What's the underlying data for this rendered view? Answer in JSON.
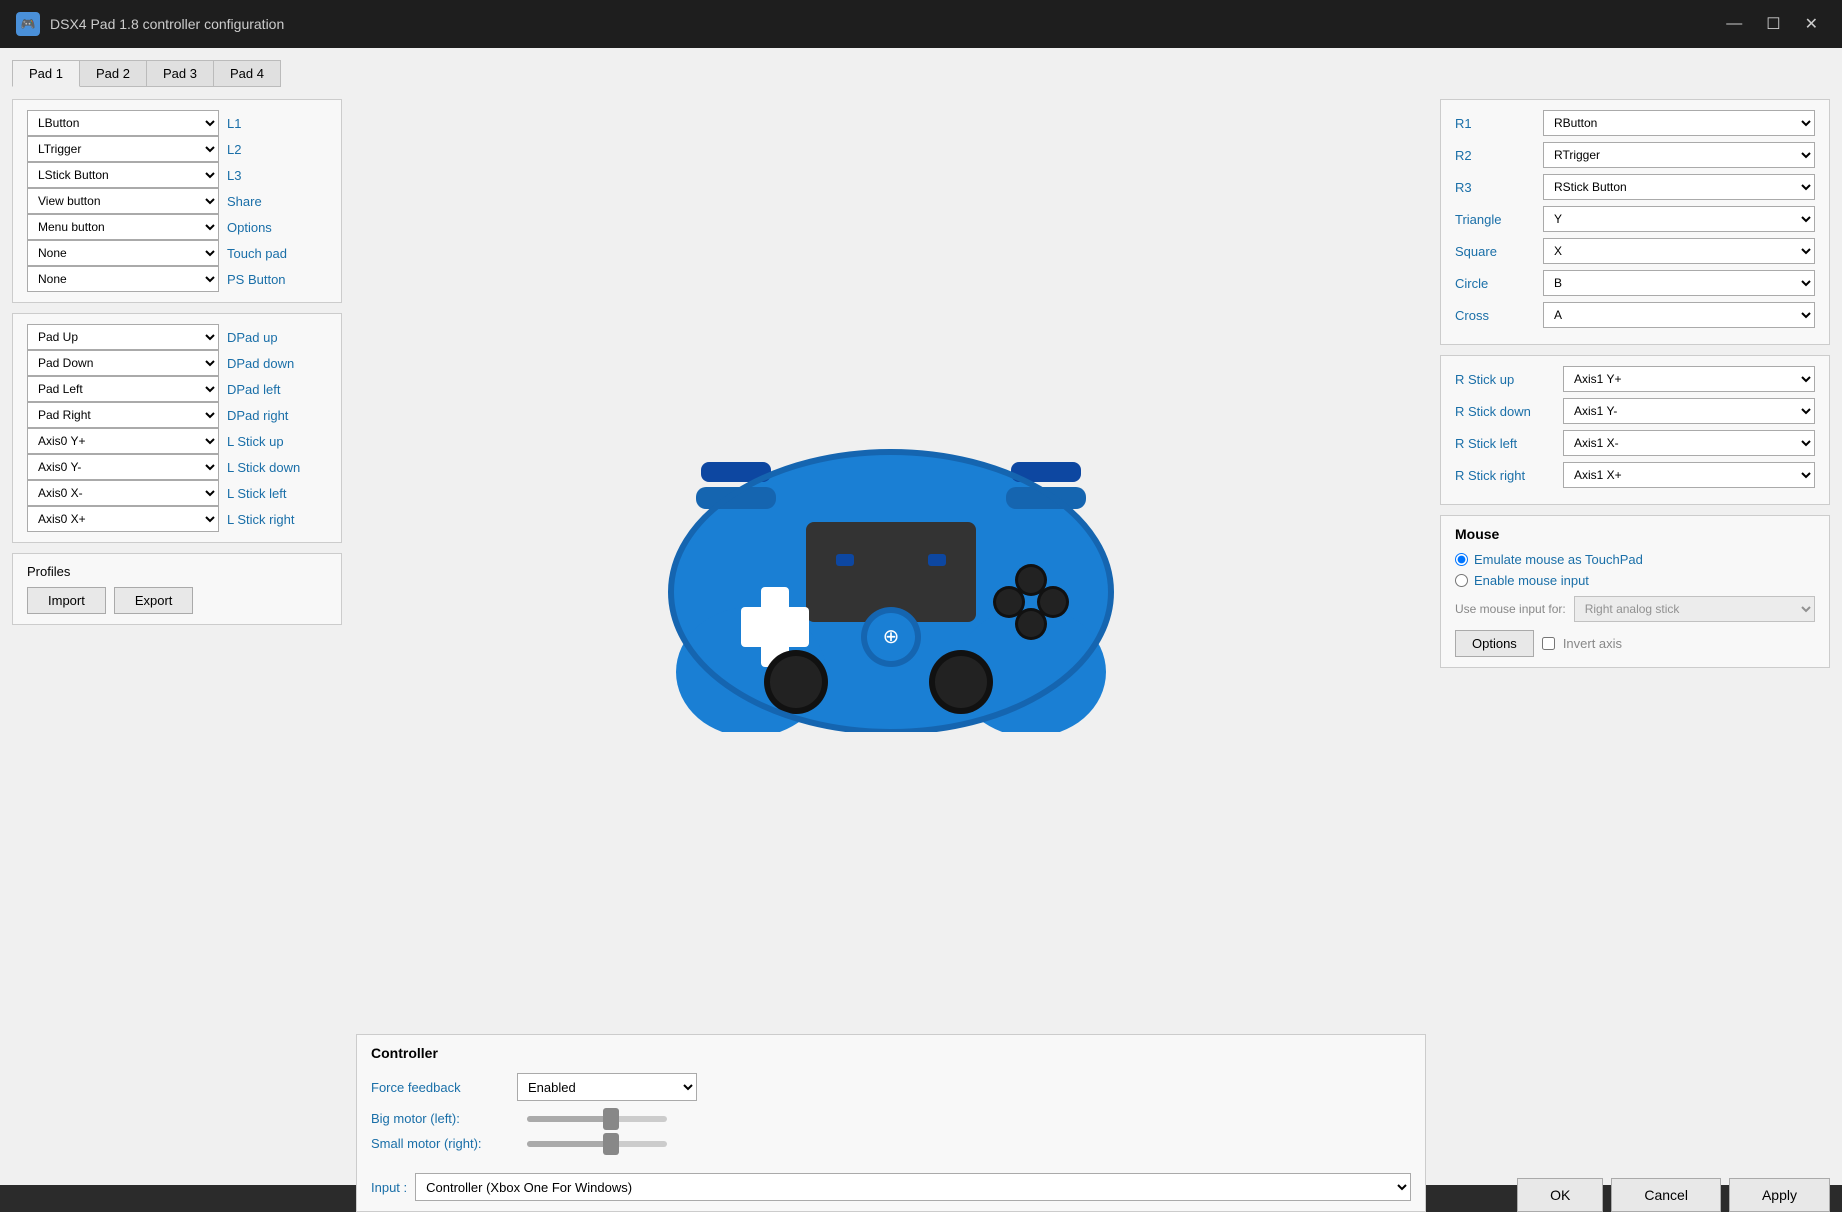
{
  "window": {
    "title": "DSX4 Pad 1.8 controller configuration",
    "icon": "🎮"
  },
  "titlebar": {
    "minimize": "—",
    "maximize": "☐",
    "close": "✕"
  },
  "tabs": [
    {
      "label": "Pad 1",
      "active": true
    },
    {
      "label": "Pad 2",
      "active": false
    },
    {
      "label": "Pad 3",
      "active": false
    },
    {
      "label": "Pad 4",
      "active": false
    }
  ],
  "left_mappings": [
    {
      "key": "L1",
      "value": "LButton"
    },
    {
      "key": "L2",
      "value": "LTrigger"
    },
    {
      "key": "L3",
      "value": "LStick Button"
    },
    {
      "key": "Share",
      "value": "View button"
    },
    {
      "key": "Options",
      "value": "Menu button"
    },
    {
      "key": "Touch pad",
      "value": "None"
    },
    {
      "key": "PS Button",
      "value": "None"
    }
  ],
  "dpad_mappings": [
    {
      "key": "DPad up",
      "value": "Pad Up"
    },
    {
      "key": "DPad down",
      "value": "Pad Down"
    },
    {
      "key": "DPad left",
      "value": "Pad Left"
    },
    {
      "key": "DPad right",
      "value": "Pad Right"
    }
  ],
  "lstick_mappings": [
    {
      "key": "L Stick up",
      "value": "Axis0 Y+"
    },
    {
      "key": "L Stick down",
      "value": "Axis0 Y-"
    },
    {
      "key": "L Stick left",
      "value": "Axis0 X-"
    },
    {
      "key": "L Stick right",
      "value": "Axis0 X+"
    }
  ],
  "profiles": {
    "title": "Profiles",
    "import": "Import",
    "export": "Export"
  },
  "right_button_mappings": [
    {
      "key": "R1",
      "value": "RButton"
    },
    {
      "key": "R2",
      "value": "RTrigger"
    },
    {
      "key": "R3",
      "value": "RStick Button"
    },
    {
      "key": "Triangle",
      "value": "Y"
    },
    {
      "key": "Square",
      "value": "X"
    },
    {
      "key": "Circle",
      "value": "B"
    },
    {
      "key": "Cross",
      "value": "A"
    }
  ],
  "rstick_mappings": [
    {
      "key": "R Stick up",
      "value": "Axis1 Y+"
    },
    {
      "key": "R Stick down",
      "value": "Axis1 Y-"
    },
    {
      "key": "R Stick left",
      "value": "Axis1 X-"
    },
    {
      "key": "R Stick right",
      "value": "Axis1 X+"
    }
  ],
  "controller_section": {
    "title": "Controller",
    "force_feedback_label": "Force feedback",
    "force_feedback_value": "Enabled",
    "big_motor_label": "Big motor (left):",
    "small_motor_label": "Small motor (right):",
    "input_label": "Input :",
    "input_value": "Controller (Xbox One For Windows)"
  },
  "mouse_section": {
    "title": "Mouse",
    "option1": "Emulate mouse as TouchPad",
    "option2": "Enable mouse input",
    "use_mouse_label": "Use mouse input for:",
    "use_mouse_value": "Right analog stick",
    "options_btn": "Options",
    "invert_axis": "Invert axis"
  },
  "bottom_buttons": {
    "ok": "OK",
    "cancel": "Cancel",
    "apply": "Apply"
  }
}
